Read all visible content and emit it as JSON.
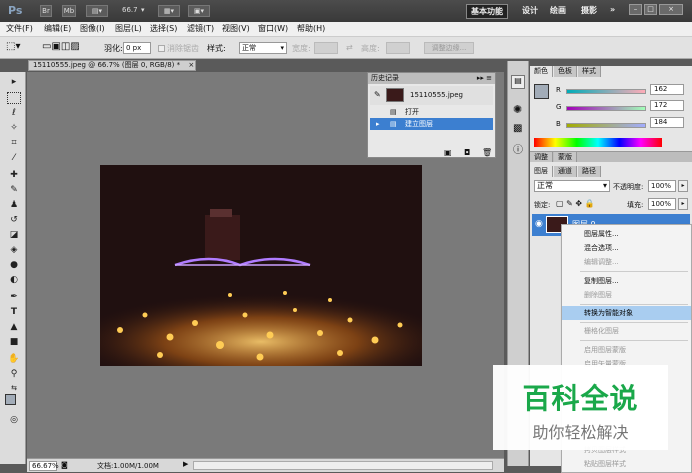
{
  "app": {
    "logo": "Ps",
    "zoom": "66.7",
    "workspaces": [
      "基本功能",
      "设计",
      "绘画",
      "摄影"
    ],
    "more": "»"
  },
  "window_buttons": [
    "–",
    "□",
    "×"
  ],
  "menus": [
    "文件(F)",
    "编辑(E)",
    "图像(I)",
    "图层(L)",
    "选择(S)",
    "滤镜(T)",
    "视图(V)",
    "窗口(W)",
    "帮助(H)"
  ],
  "options": {
    "feather_label": "羽化:",
    "feather_value": "0 px",
    "antialias": "消除锯齿",
    "style_label": "样式:",
    "style_value": "正常",
    "width_label": "宽度:",
    "height_label": "高度:",
    "refine_button": "调整边缘..."
  },
  "document": {
    "tab_title": "15110555.jpeg @ 66.7% (图层 0, RGB/8) *",
    "close": "×"
  },
  "status": {
    "zoom": "66.67%",
    "doc_info": "文档:1.00M/1.00M"
  },
  "history": {
    "title": "历史记录",
    "snapshot": "15110555.jpeg",
    "items": [
      "打开",
      "建立图层"
    ]
  },
  "color_panel": {
    "tabs": [
      "颜色",
      "色板",
      "样式"
    ],
    "r_label": "R",
    "g_label": "G",
    "b_label": "B",
    "r": "162",
    "g": "172",
    "b": "184",
    "swatch": "#a2acb8"
  },
  "adjust_tabs": [
    "调整",
    "蒙版"
  ],
  "layers_panel": {
    "tabs": [
      "图层",
      "通道",
      "路径"
    ],
    "blend_mode": "正常",
    "opacity_label": "不透明度:",
    "opacity": "100%",
    "lock_label": "锁定:",
    "fill_label": "填充:",
    "fill": "100%",
    "layer_name": "图层 0"
  },
  "context_menu": [
    {
      "label": "图层属性...",
      "disabled": false
    },
    {
      "label": "混合选项...",
      "disabled": false
    },
    {
      "label": "编辑调整...",
      "disabled": true
    },
    {
      "label": "复制图层...",
      "disabled": false
    },
    {
      "label": "删除图层",
      "disabled": true
    },
    {
      "label": "转换为智能对象",
      "disabled": false,
      "highlight": true
    },
    {
      "label": "栅格化图层",
      "disabled": true
    },
    {
      "label": "启用图层蒙版",
      "disabled": true
    },
    {
      "label": "启用矢量蒙版",
      "disabled": true
    },
    {
      "label": "拷贝图层样式",
      "disabled": true
    },
    {
      "label": "粘贴图层样式",
      "disabled": true
    }
  ],
  "watermark": {
    "title": "百科全说",
    "subtitle": "助你轻松解决"
  }
}
